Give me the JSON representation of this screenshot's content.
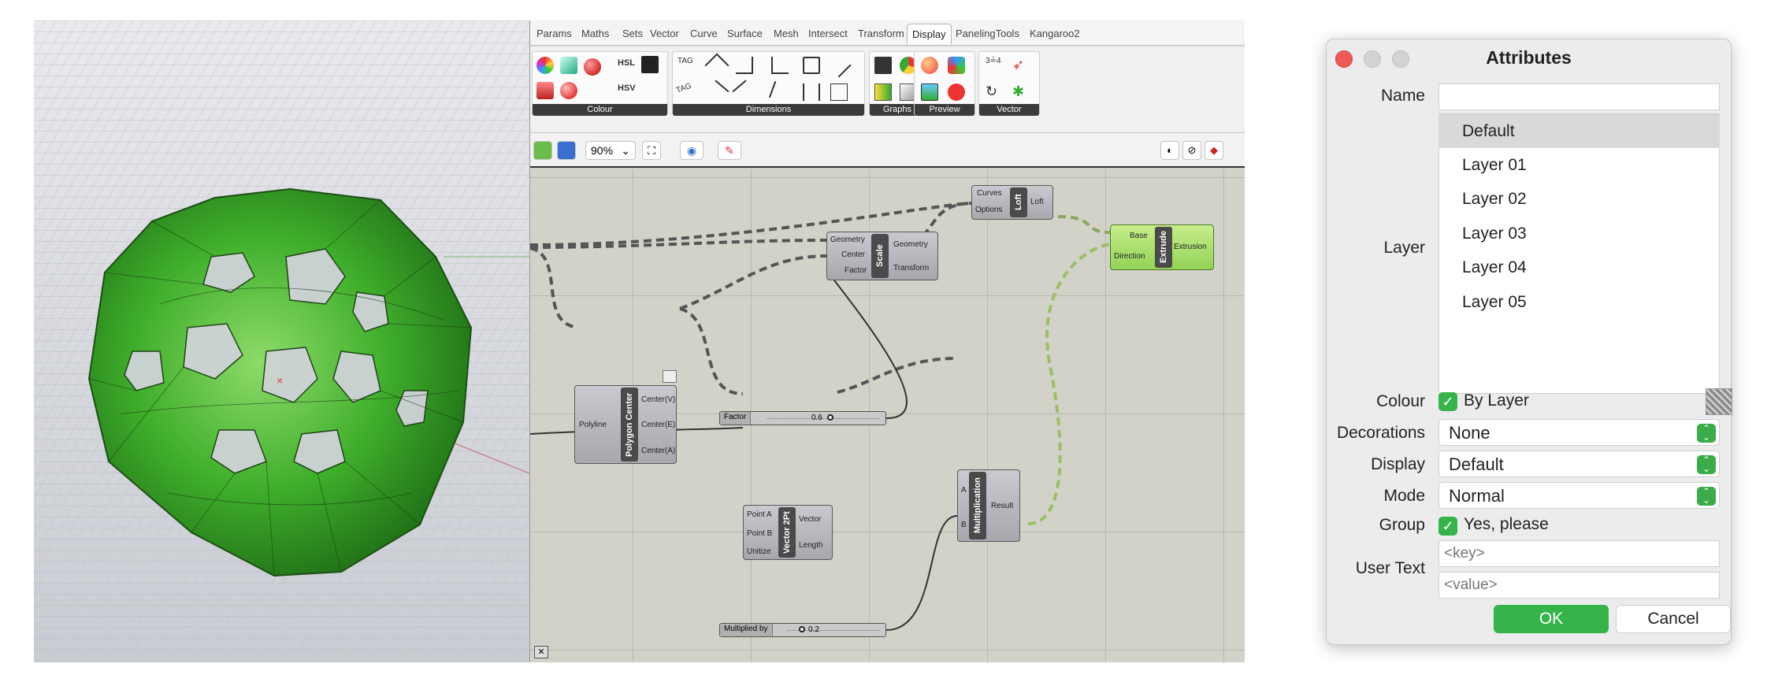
{
  "gh": {
    "tabs": [
      "Params",
      "Maths",
      "Sets",
      "Vector",
      "Curve",
      "Surface",
      "Mesh",
      "Intersect",
      "Transform",
      "Display",
      "PanelingTools",
      "Kangaroo2"
    ],
    "active_tab": "Display",
    "panels": [
      "Colour",
      "Dimensions",
      "Graphs",
      "Preview",
      "Vector"
    ],
    "zoom": "90%",
    "components": {
      "polygon_center": {
        "title": "Polygon Center",
        "in": [
          "Polyline"
        ],
        "out": [
          "Center(V)",
          "Center(E)",
          "Center(A)"
        ]
      },
      "scale": {
        "title": "Scale",
        "in": [
          "Geometry",
          "Center",
          "Factor"
        ],
        "out": [
          "Geometry",
          "Transform"
        ]
      },
      "loft": {
        "title": "Loft",
        "in": [
          "Curves",
          "Options"
        ],
        "out": [
          "Loft"
        ]
      },
      "extrude": {
        "title": "Extrude",
        "in": [
          "Base",
          "Direction"
        ],
        "out": [
          "Extrusion"
        ]
      },
      "vector2pt": {
        "title": "Vector 2Pt",
        "in": [
          "Point A",
          "Point B",
          "Unitize"
        ],
        "out": [
          "Vector",
          "Length"
        ]
      },
      "multiplication": {
        "title": "Multiplication",
        "in": [
          "A",
          "B"
        ],
        "out": [
          "Result"
        ]
      }
    },
    "sliders": [
      {
        "label": "Factor",
        "value": "0.6"
      },
      {
        "label": "Multiplied by",
        "value": "0.2"
      }
    ]
  },
  "dialog": {
    "title": "Attributes",
    "name_label": "Name",
    "name_value": "",
    "layer_label": "Layer",
    "layers": [
      "Default",
      "Layer 01",
      "Layer 02",
      "Layer 03",
      "Layer 04",
      "Layer 05"
    ],
    "selected_layer": "Default",
    "colour_label": "Colour",
    "colour_value": "By Layer",
    "decorations_label": "Decorations",
    "decorations_value": "None",
    "display_label": "Display",
    "display_value": "Default",
    "mode_label": "Mode",
    "mode_value": "Normal",
    "group_label": "Group",
    "group_value": "Yes, please",
    "user_text_label": "User Text",
    "key_placeholder": "<key>",
    "value_placeholder": "<value>",
    "ok": "OK",
    "cancel": "Cancel"
  },
  "colors": {
    "accent_green": "#36b44a",
    "mesh_green": "#3fae2b",
    "canvas": "#d2d2c9"
  }
}
